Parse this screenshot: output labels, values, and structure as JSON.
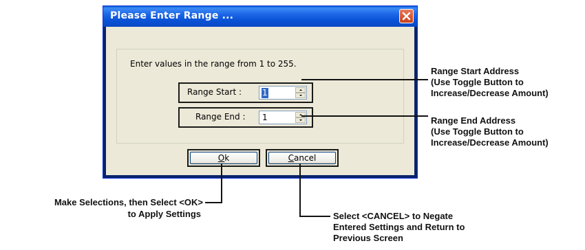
{
  "dialog": {
    "title": "Please Enter Range ...",
    "instruction": "Enter values in the range from 1 to 255.",
    "range_start": {
      "label": "Range Start :",
      "value": "1"
    },
    "range_end": {
      "label": "Range End :",
      "value": "1"
    },
    "ok_label": "Ok",
    "ok_mnemonic": "O",
    "ok_rest": "k",
    "cancel_mnemonic": "C",
    "cancel_rest": "ancel"
  },
  "annotations": {
    "range_start": [
      "Range Start Address",
      "(Use Toggle Button to",
      "Increase/Decrease Amount)"
    ],
    "range_end": [
      "Range End Address",
      "(Use Toggle Button to",
      "Increase/Decrease Amount)"
    ],
    "ok": [
      "Make Selections, then Select <OK>",
      "to Apply Settings"
    ],
    "cancel": [
      "Select <CANCEL> to Negate",
      "Entered Settings and Return to",
      "Previous Screen"
    ]
  },
  "colors": {
    "titlebar": "#0A52D6",
    "dialog_bg": "#ECE9D8",
    "close_button": "#C8401A",
    "selection": "#316AC5"
  }
}
